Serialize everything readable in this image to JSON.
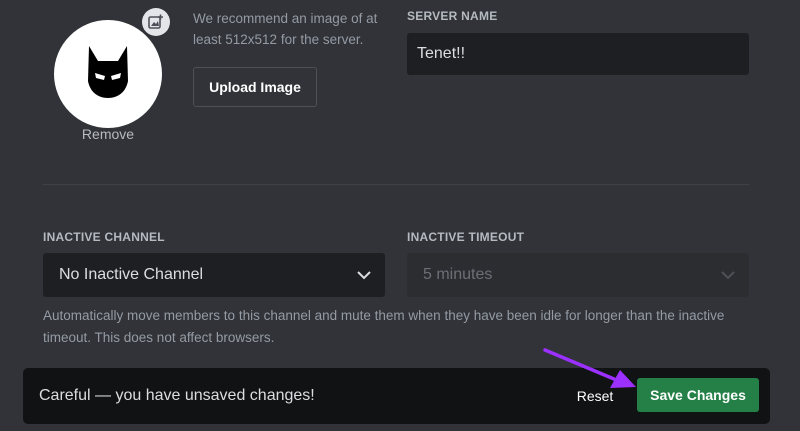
{
  "icon": {
    "server_avatar": "batman-mask-icon",
    "add_image": "add-image-icon",
    "chevron": "chevron-down-icon"
  },
  "overview": {
    "remove_label": "Remove",
    "recommend_text": "We recommend an image of at least 512x512 for the server.",
    "upload_label": "Upload Image",
    "server_name_label": "SERVER NAME",
    "server_name_value": "Tenet!!"
  },
  "inactive": {
    "channel_label": "INACTIVE CHANNEL",
    "channel_value": "No Inactive Channel",
    "timeout_label": "INACTIVE TIMEOUT",
    "timeout_value": "5 minutes",
    "help_text": "Automatically move members to this channel and mute them when they have been idle for longer than the inactive timeout. This does not affect browsers."
  },
  "notice": {
    "message": "Careful — you have unsaved changes!",
    "reset_label": "Reset",
    "save_label": "Save Changes"
  },
  "colors": {
    "background": "#313338",
    "input_bg": "#1e1f22",
    "notice_bg": "#111214",
    "save_green": "#248046",
    "annotation_arrow": "#9b30ff"
  }
}
